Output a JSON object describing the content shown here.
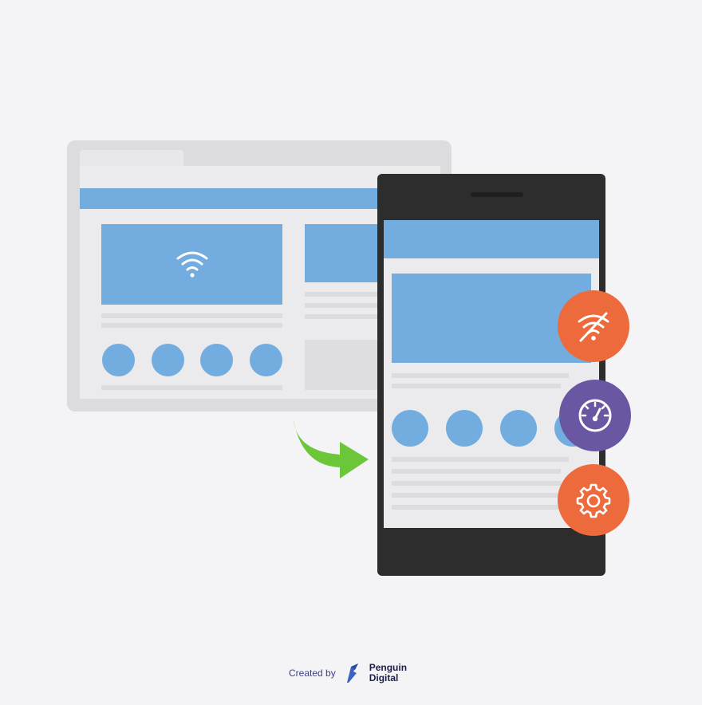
{
  "footer": {
    "created_by": "Created by",
    "brand_name": "Penguin Digital"
  },
  "icons": {
    "browser_hero": "wifi-icon",
    "badge_top": "wifi-off-icon",
    "badge_middle": "speedometer-icon",
    "badge_bottom": "gear-icon",
    "arrow": "curved-arrow-icon",
    "brand_logo": "penguin-digital-logo"
  },
  "colors": {
    "background": "#f4f4f7",
    "block_blue": "#73addf",
    "phone_body": "#2d2d2d",
    "badge_orange": "#ec6a3c",
    "badge_purple": "#6957a3",
    "arrow_green": "#6cc63a",
    "brand_navy": "#1c1f4a"
  }
}
